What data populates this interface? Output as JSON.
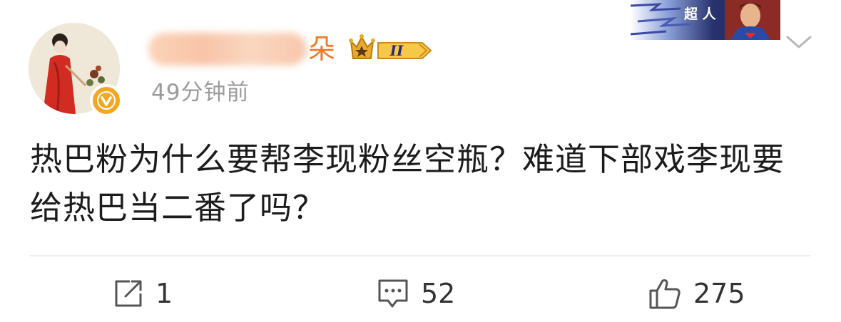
{
  "user": {
    "name_visible_suffix": "朵",
    "level_badge": "II",
    "time": "49分钟前"
  },
  "banner": {
    "text": "超 人"
  },
  "post": {
    "text": "热巴粉为什么要帮李现粉丝空瓶？难道下部戏李现要给热巴当二番了吗？"
  },
  "actions": {
    "repost_count": "1",
    "comment_count": "52",
    "like_count": "275"
  },
  "colors": {
    "name_orange": "#f07a2c",
    "verified_badge": "#f5a623",
    "time_gray": "#9b9b9b"
  }
}
